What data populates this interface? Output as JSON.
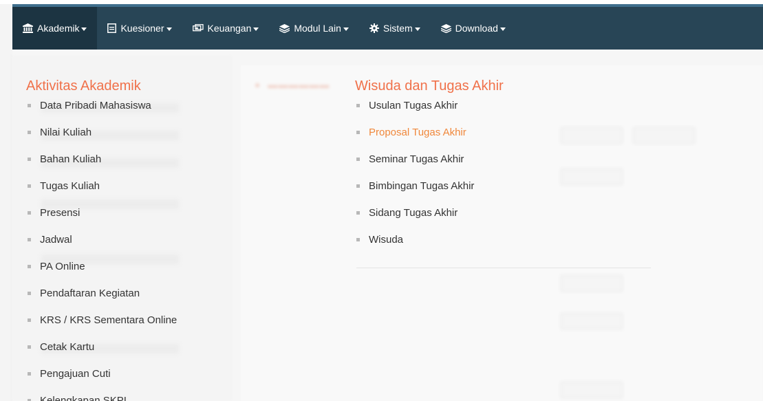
{
  "navbar": {
    "items": [
      {
        "label": "Akademik",
        "icon": "institution-icon",
        "active": true
      },
      {
        "label": "Kuesioner",
        "icon": "form-icon",
        "active": false
      },
      {
        "label": "Keuangan",
        "icon": "money-icon",
        "active": false
      },
      {
        "label": "Modul Lain",
        "icon": "layers-icon",
        "active": false
      },
      {
        "label": "Sistem",
        "icon": "gear-icon",
        "active": false
      },
      {
        "label": "Download",
        "icon": "layers-icon",
        "active": false
      }
    ]
  },
  "mega_menu": {
    "akademik": {
      "title": "Aktivitas Akademik",
      "items": [
        "Data Pribadi Mahasiswa",
        "Nilai Kuliah",
        "Bahan Kuliah",
        "Tugas Kuliah",
        "Presensi",
        "Jadwal",
        "PA Online",
        "Pendaftaran Kegiatan",
        "KRS / KRS Sementara Online",
        "Cetak Kartu",
        "Pengajuan Cuti",
        "Kelengkapan SKPI"
      ]
    },
    "wisuda": {
      "title": "Wisuda dan Tugas Akhir",
      "items": [
        "Usulan Tugas Akhir",
        "Proposal Tugas Akhir",
        "Seminar Tugas Akhir",
        "Bimbingan Tugas Akhir",
        "Sidang Tugas Akhir",
        "Wisuda"
      ],
      "highlighted": "Proposal Tugas Akhir"
    }
  },
  "colors": {
    "navbar_bg": "#284556",
    "navbar_active": "#1c3442",
    "section_title": "#f0714a",
    "highlight": "#f0883c"
  }
}
